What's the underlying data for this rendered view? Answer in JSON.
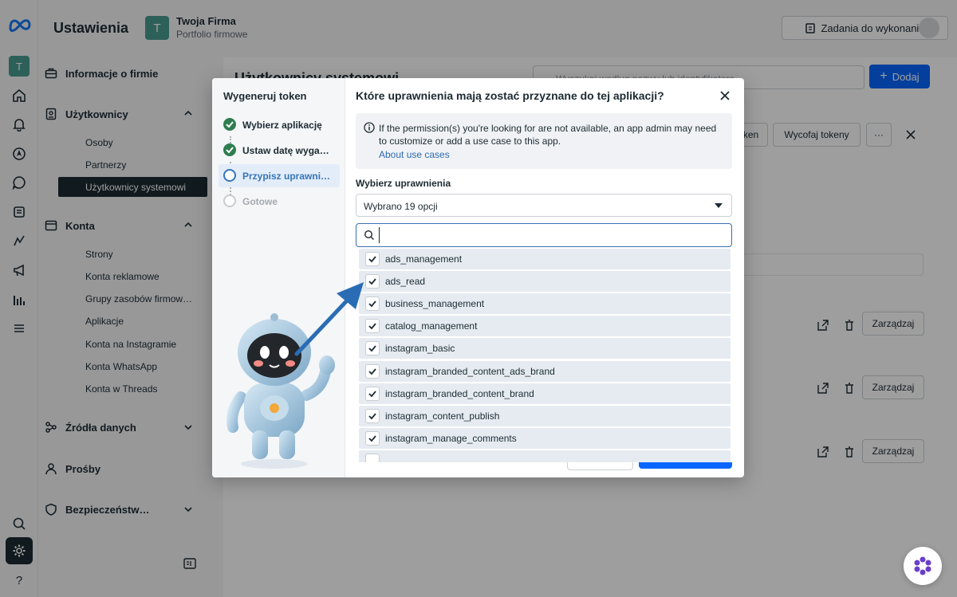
{
  "app": {
    "title": "Ustawienia"
  },
  "business": {
    "initial": "T",
    "name": "Twoja Firma",
    "subtitle": "Portfolio firmowe"
  },
  "header": {
    "todo_label": "Zadania do wykonania"
  },
  "rail": {
    "initial": "T"
  },
  "sidebar": {
    "sections": [
      {
        "label": "Informacje o firmie"
      },
      {
        "label": "Użytkownicy",
        "items": [
          "Osoby",
          "Partnerzy",
          "Użytkownicy systemowi"
        ],
        "active": "Użytkownicy systemowi"
      },
      {
        "label": "Konta",
        "items": [
          "Strony",
          "Konta reklamowe",
          "Grupy zasobów firmow…",
          "Aplikacje",
          "Konta na Instagramie",
          "Konta WhatsApp",
          "Konta w Threads"
        ]
      },
      {
        "label": "Źródła danych"
      },
      {
        "label": "Prośby"
      },
      {
        "label": "Bezpieczeństw…"
      }
    ]
  },
  "main": {
    "title": "Użytkownicy systemowi",
    "search_placeholder": "Wyszukaj według nazwy lub identyfikatora",
    "add_label": "Dodaj",
    "token_btn_partial": "ken",
    "revoke_label": "Wycofaj tokeny",
    "more_label": "···",
    "manage_label": "Zarządzaj"
  },
  "modal": {
    "steps_title": "Wygeneruj token",
    "steps": [
      {
        "label": "Wybierz aplikację",
        "state": "done"
      },
      {
        "label": "Ustaw datę wyga…",
        "state": "done"
      },
      {
        "label": "Przypisz uprawni…",
        "state": "current"
      },
      {
        "label": "Gotowe",
        "state": "todo"
      }
    ],
    "title": "Które uprawnienia mają zostać przyznane do tej aplikacji?",
    "info_text": "If the permission(s) you're looking for are not available, an app admin may need to customize or add a use case to this app.",
    "info_link": "About use cases",
    "select_label": "Wybierz uprawnienia",
    "select_value": "Wybrano 19 opcji",
    "search_value": "",
    "options": [
      "ads_management",
      "ads_read",
      "business_management",
      "catalog_management",
      "instagram_basic",
      "instagram_branded_content_ads_brand",
      "instagram_branded_content_brand",
      "instagram_content_publish",
      "instagram_manage_comments"
    ]
  },
  "colors": {
    "primary": "#0866ff",
    "dark": "#1c2b33",
    "success": "#2e7d4f",
    "link": "#2d6bb3",
    "arrow": "#2a6db5"
  }
}
